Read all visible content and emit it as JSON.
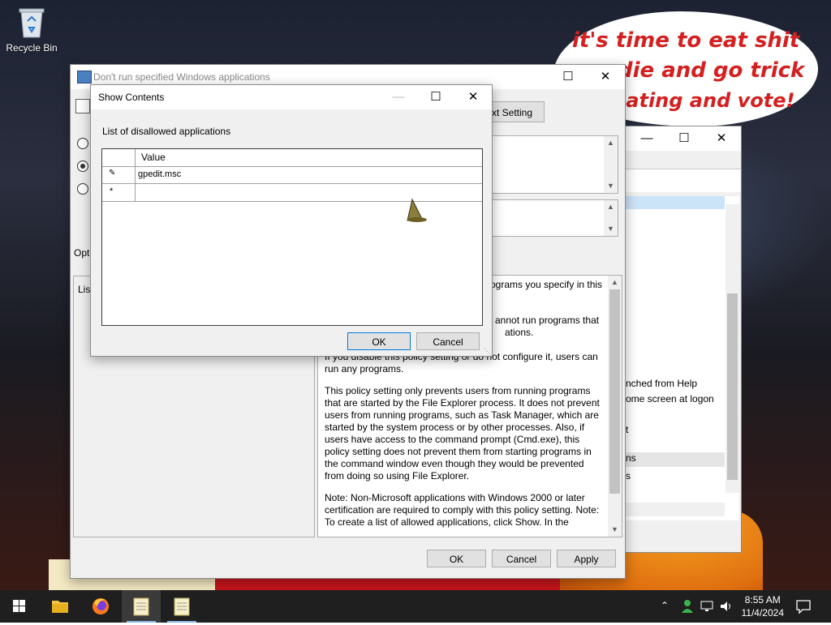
{
  "desktop": {
    "recycle_bin_label": "Recycle Bin",
    "wallpaper_text": [
      "it's time to eat shit",
      "die and go trick",
      "eating and vote!"
    ]
  },
  "policy_window": {
    "title": "Don't run specified Windows applications",
    "next_setting_partial": "xt Setting",
    "options_partial": "Opt",
    "list_partial": "List",
    "help_first_line_partial": "rograms you specify in this",
    "help_partial_lines": [
      "annot run programs that",
      "ations."
    ],
    "help_paragraphs": [
      "If you disable this policy setting or do not configure it, users can run any programs.",
      "This policy setting only prevents users from running programs that are started by the File Explorer process. It does not prevent users from running programs, such as Task Manager, which are started by the system process or by other processes.  Also, if users have access to the command prompt (Cmd.exe), this policy setting does not prevent them from starting programs in the command window even though they would be prevented from doing so using File Explorer.",
      "Note: Non-Microsoft applications with Windows 2000 or later certification are required to comply with this policy setting. Note: To create a list of allowed applications, click Show.  In the"
    ],
    "ok": "OK",
    "cancel": "Cancel",
    "apply": "Apply"
  },
  "background_window": {
    "partial_items": [
      "nched from Help",
      "ome screen at logon",
      "t",
      "ns",
      "s"
    ]
  },
  "show_contents": {
    "title": "Show Contents",
    "list_label": "List of disallowed applications",
    "column_header": "Value",
    "rows": [
      {
        "marker": "✎",
        "value": "gpedit.msc"
      },
      {
        "marker": "*",
        "value": ""
      }
    ],
    "ok": "OK",
    "cancel": "Cancel"
  },
  "taskbar": {
    "time": "8:55 AM",
    "date": "11/4/2024",
    "apps": [
      "start",
      "file-explorer",
      "firefox",
      "notepad",
      "notepad"
    ]
  }
}
